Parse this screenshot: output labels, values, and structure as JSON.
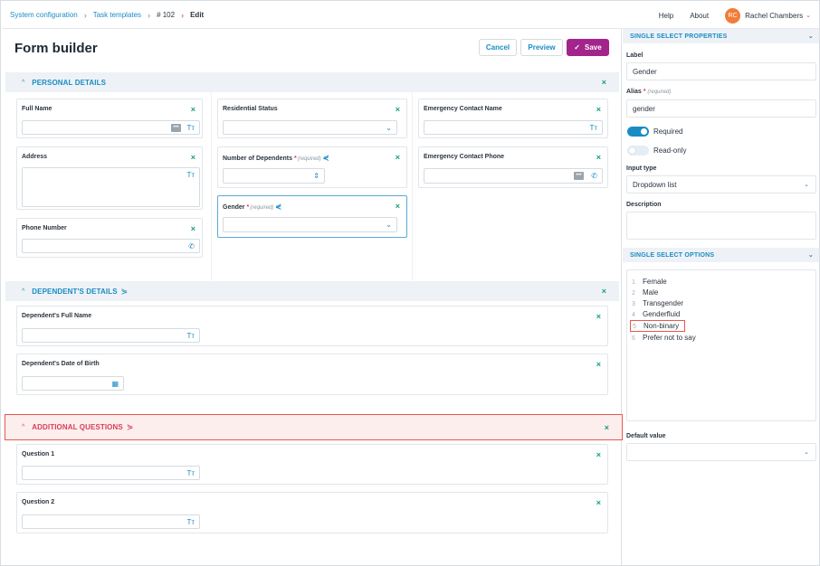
{
  "breadcrumb": {
    "items": [
      "System configuration",
      "Task templates",
      "# 102",
      "Edit"
    ]
  },
  "topnav": {
    "help": "Help",
    "about": "About"
  },
  "user": {
    "initials": "RC",
    "name": "Rachel Chambers",
    "avatar_color": "#f07d3a"
  },
  "page": {
    "title": "Form builder"
  },
  "actions": {
    "cancel": "Cancel",
    "preview": "Preview",
    "save": "Save"
  },
  "colors": {
    "accent": "#1a8cc4",
    "save": "#a3248b",
    "close": "#1a9c84",
    "alert": "#d8405a"
  },
  "sections": {
    "personal": {
      "title": "PERSONAL DETAILS"
    },
    "dependents": {
      "title": "DEPENDENT'S DETAILS"
    },
    "additional": {
      "title": "ADDITIONAL QUESTIONS"
    }
  },
  "fields": {
    "full_name": "Full Name",
    "address": "Address",
    "phone": "Phone Number",
    "residential": "Residential Status",
    "num_dependents": "Number of Dependents",
    "gender": "Gender",
    "emergency_name": "Emergency Contact Name",
    "emergency_phone": "Emergency Contact Phone",
    "dep_full_name": "Dependent's Full Name",
    "dep_dob": "Dependent's Date of Birth",
    "question1": "Question 1",
    "question2": "Question 2",
    "required_tag": "(required)"
  },
  "panel": {
    "props_title": "SINGLE SELECT PROPERTIES",
    "label_label": "Label",
    "label_value": "Gender",
    "alias_label": "Alias",
    "alias_req": "(required)",
    "alias_value": "gender",
    "required_label": "Required",
    "readonly_label": "Read-only",
    "input_type_label": "Input type",
    "input_type_value": "Dropdown list",
    "description_label": "Description",
    "options_title": "SINGLE SELECT OPTIONS",
    "options": [
      {
        "n": "1",
        "label": "Female"
      },
      {
        "n": "2",
        "label": "Male"
      },
      {
        "n": "3",
        "label": "Transgender"
      },
      {
        "n": "4",
        "label": "Genderfluid"
      },
      {
        "n": "5",
        "label": "Non-binary"
      },
      {
        "n": "6",
        "label": "Prefer not to say"
      }
    ],
    "default_label": "Default value",
    "required_on": true,
    "readonly_on": false
  }
}
